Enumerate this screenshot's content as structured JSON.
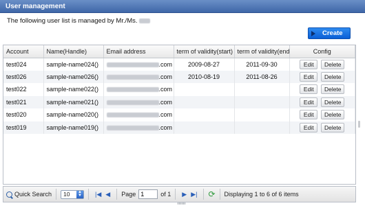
{
  "window": {
    "title": "User management"
  },
  "description": {
    "prefix": "The following user list is managed by Mr./Ms."
  },
  "toolbar": {
    "create_label": "Create"
  },
  "table": {
    "columns": [
      "Account",
      "Name(Handle)",
      "Email address",
      "term of validity(start)",
      "term of validity(end)",
      "Config"
    ],
    "rows": [
      {
        "account": "test024",
        "name": "sample-name024()",
        "email_suffix": ".com",
        "start": "2009-08-27",
        "end": "2011-09-30"
      },
      {
        "account": "test026",
        "name": "sample-name026()",
        "email_suffix": ".com",
        "start": "2010-08-19",
        "end": "2011-08-26"
      },
      {
        "account": "test022",
        "name": "sample-name022()",
        "email_suffix": ".com",
        "start": "",
        "end": ""
      },
      {
        "account": "test021",
        "name": "sample-name021()",
        "email_suffix": ".com",
        "start": "",
        "end": ""
      },
      {
        "account": "test020",
        "name": "sample-name020()",
        "email_suffix": ".com",
        "start": "",
        "end": ""
      },
      {
        "account": "test019",
        "name": "sample-name019()",
        "email_suffix": ".com",
        "start": "",
        "end": ""
      }
    ],
    "edit_label": "Edit",
    "delete_label": "Delete"
  },
  "pager": {
    "quick_search_label": "Quick Search",
    "page_size": "10",
    "page_label": "Page",
    "page_value": "1",
    "of_label": "of 1",
    "status": "Displaying 1 to 6 of 6 items"
  },
  "colors": {
    "titlebar": "#4a72b3",
    "create_button": "#1a73e8"
  },
  "icons": [
    "play-icon",
    "magnifier-icon",
    "first-page-icon",
    "prev-page-icon",
    "next-page-icon",
    "last-page-icon",
    "refresh-icon"
  ]
}
